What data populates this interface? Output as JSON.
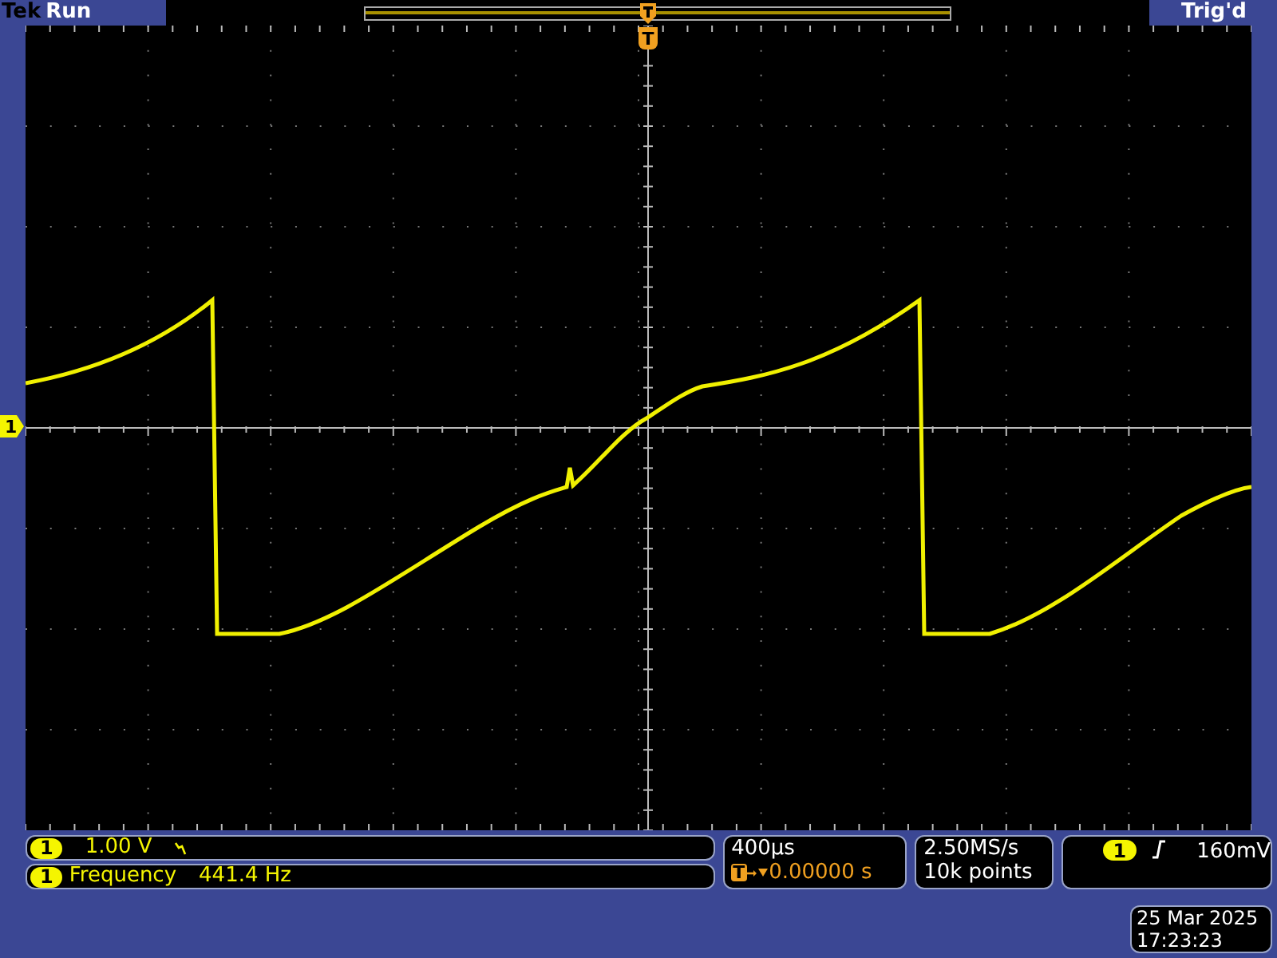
{
  "status": {
    "brand": "Tek",
    "acquisition": "Run",
    "trigger_state": "Trig'd"
  },
  "graticule": {
    "trigger_marker": "T",
    "channel_marker": "1"
  },
  "channel": {
    "number": "1",
    "scale": "1.00 V"
  },
  "measurement": {
    "channel": "1",
    "label": "Frequency",
    "value": "441.4 Hz"
  },
  "timebase": {
    "scale": "400µs",
    "trigger_marker": "T",
    "delay": "0.00000 s"
  },
  "acquisition": {
    "sample_rate": "2.50MS/s",
    "record_length": "10k points"
  },
  "trigger": {
    "channel": "1",
    "threshold": "160mV"
  },
  "datetime": {
    "date": "25 Mar 2025",
    "time": "17:23:23"
  }
}
